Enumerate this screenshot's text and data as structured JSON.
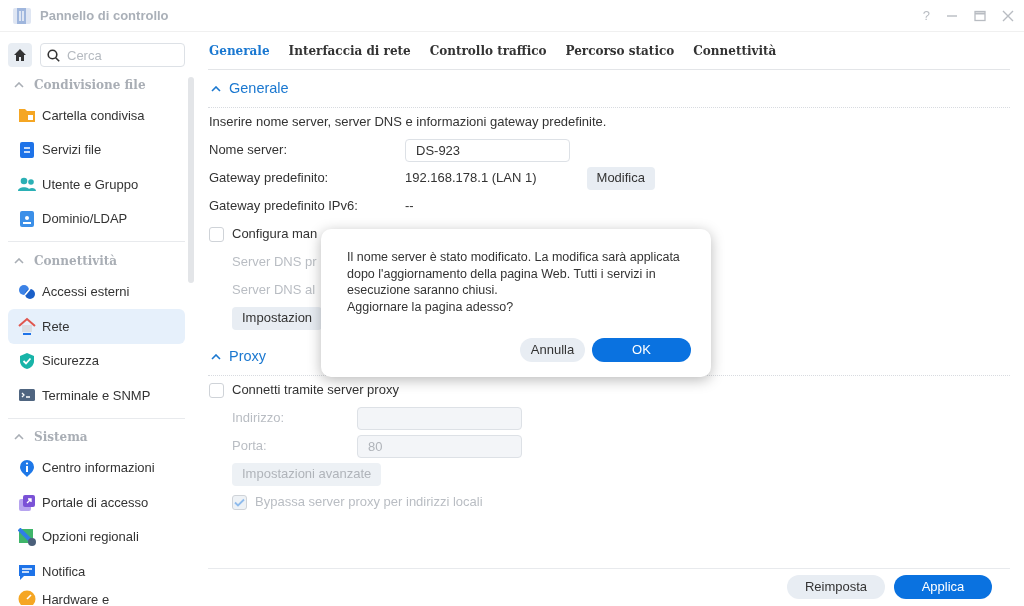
{
  "window": {
    "title": "Pannello di controllo",
    "help": "?"
  },
  "sidebar": {
    "search": {
      "placeholder": "Cerca"
    },
    "groups": [
      {
        "title": "Condivisione file",
        "expanded": true,
        "items": [
          {
            "label": "Cartella condivisa",
            "selected": false
          },
          {
            "label": "Servizi file",
            "selected": false
          },
          {
            "label": "Utente e Gruppo",
            "selected": false
          },
          {
            "label": "Dominio/LDAP",
            "selected": false
          }
        ]
      },
      {
        "title": "Connettività",
        "expanded": true,
        "items": [
          {
            "label": "Accessi esterni",
            "selected": false
          },
          {
            "label": "Rete",
            "selected": true
          },
          {
            "label": "Sicurezza",
            "selected": false
          },
          {
            "label": "Terminale e SNMP",
            "selected": false
          }
        ]
      },
      {
        "title": "Sistema",
        "expanded": true,
        "items": [
          {
            "label": "Centro informazioni",
            "selected": false
          },
          {
            "label": "Portale di accesso",
            "selected": false
          },
          {
            "label": "Opzioni regionali",
            "selected": false
          },
          {
            "label": "Notifica",
            "selected": false
          },
          {
            "label": "Hardware e",
            "selected": false
          }
        ]
      }
    ]
  },
  "tabs": [
    {
      "label": "Generale",
      "selected": true
    },
    {
      "label": "Interfaccia di rete",
      "selected": false
    },
    {
      "label": "Controllo traffico",
      "selected": false
    },
    {
      "label": "Percorso statico",
      "selected": false
    },
    {
      "label": "Connettività",
      "selected": false
    }
  ],
  "sections": [
    {
      "title": "Generale",
      "expanded": true,
      "rows": [
        {
          "kind": "text",
          "text": "Inserire nome server, server DNS e informazioni gateway predefinite."
        },
        {
          "kind": "field",
          "label": "Nome server:",
          "value": "DS-923",
          "disabled": false
        },
        {
          "kind": "value",
          "label": "Gateway predefinito:",
          "value": "192.168.178.1 (LAN 1)",
          "button": "Modifica"
        },
        {
          "kind": "value",
          "label": "Gateway predefinito IPv6:",
          "value": "--"
        },
        {
          "kind": "checkbox",
          "label": "Configura man",
          "checked": false,
          "disabled": false,
          "children": [
            {
              "kind": "label",
              "label": "Server DNS pr",
              "disabled": true
            },
            {
              "kind": "label",
              "label": "Server DNS al",
              "disabled": true
            },
            {
              "kind": "button",
              "label": "Impostazion",
              "disabled": false
            }
          ]
        }
      ]
    },
    {
      "title": "Proxy",
      "expanded": true,
      "rows": [
        {
          "kind": "checkbox",
          "label": "Connetti tramite server proxy",
          "checked": false,
          "disabled": false,
          "children": [
            {
              "kind": "field",
              "label": "Indirizzo:",
              "disabled": true
            },
            {
              "kind": "field",
              "label": "Porta:",
              "value": "80",
              "disabled": true
            },
            {
              "kind": "button",
              "label": "Impostazioni avanzate",
              "disabled": true
            },
            {
              "kind": "checkbox",
              "label": "Bypassa server proxy per indirizzi locali",
              "checked": true,
              "disabled": true
            }
          ]
        }
      ]
    }
  ],
  "footer": {
    "buttons": [
      {
        "label": "Reimposta",
        "kind": "secondary"
      },
      {
        "label": "Applica",
        "kind": "primary"
      }
    ]
  },
  "dialog": {
    "message": "Il nome server è stato modificato. La modifica sarà applicata dopo l'aggiornamento della pagina Web. Tutti i servizi in esecuzione saranno chiusi.",
    "question": "Aggiornare la pagina adesso?",
    "buttons": [
      {
        "label": "Annulla",
        "kind": "secondary"
      },
      {
        "label": "OK",
        "kind": "primary"
      }
    ]
  }
}
